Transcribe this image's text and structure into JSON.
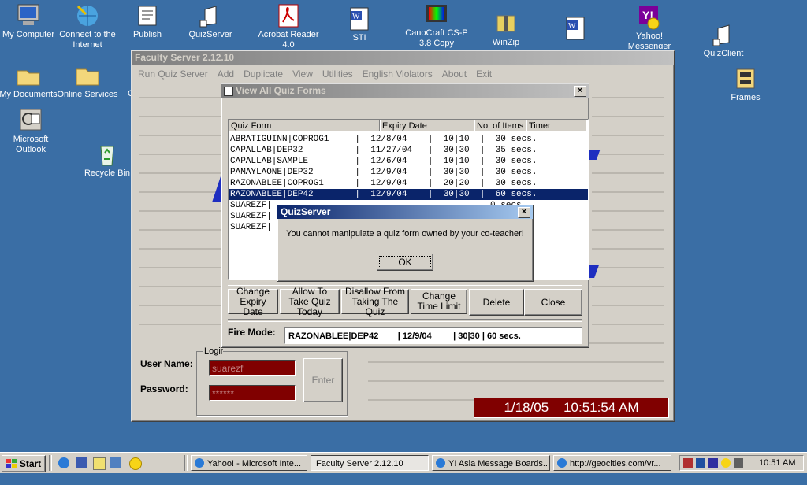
{
  "desktop": {
    "icons": [
      {
        "label": "My Computer"
      },
      {
        "label": "Connect to the Internet"
      },
      {
        "label": "Publish"
      },
      {
        "label": "QuizServer"
      },
      {
        "label": "Acrobat Reader 4.0"
      },
      {
        "label": "STI"
      },
      {
        "label": "CanoCraft CS-P 3.8 Copy"
      },
      {
        "label": "WinZip"
      },
      {
        "label": "Yahoo! Messenger"
      },
      {
        "label": "QuizClient"
      },
      {
        "label": "My Documents"
      },
      {
        "label": "Online Services"
      },
      {
        "label": "Frames"
      },
      {
        "label": "Microsoft Outlook"
      },
      {
        "label": "Recycle Bin"
      }
    ]
  },
  "main_window": {
    "title": "Faculty Server 2.12.10",
    "menu": [
      "Run Quiz Server",
      "Add",
      "Duplicate",
      "View",
      "Utilities",
      "English Violators",
      "About",
      "Exit"
    ],
    "login": {
      "group_label": "Login",
      "username_label": "User Name:",
      "username_value": "suarezf",
      "password_label": "Password:",
      "password_value": "******",
      "enter_label": "Enter"
    },
    "clock": "1/18/05    10:51:54 AM"
  },
  "quiz_window": {
    "title": "View All Quiz Forms",
    "columns": [
      "Quiz Form",
      "Expiry Date",
      "No. of Items",
      "Timer"
    ],
    "rows": [
      {
        "text": "ABRATIGUINN|COPROG1     |  12/8/04    |  10|10  |  30 secs."
      },
      {
        "text": "CAPALLAB|DEP32          |  11/27/04   |  30|30  |  35 secs."
      },
      {
        "text": "CAPALLAB|SAMPLE         |  12/6/04    |  10|10  |  30 secs."
      },
      {
        "text": "PAMAYLAONE|DEP32        |  12/9/04    |  30|30  |  30 secs."
      },
      {
        "text": "RAZONABLEE|COPROG1      |  12/9/04    |  20|20  |  30 secs."
      },
      {
        "text": "RAZONABLEE|DEP42        |  12/9/04    |  30|30  |  60 secs."
      },
      {
        "text": "SUAREZF|                                          0 secs."
      },
      {
        "text": "SUAREZF|                                          0 secs."
      },
      {
        "text": "SUAREZF|                                          0 secs."
      }
    ],
    "selected_index": 5,
    "buttons": {
      "change_expiry": "Change Expiry Date",
      "allow_today": "Allow To Take Quiz Today",
      "disallow": "Disallow From Taking The Quiz",
      "change_time": "Change Time Limit",
      "delete": "Delete",
      "close": "Close"
    },
    "fire_mode_label": "Fire Mode:",
    "fire_mode_value": "RAZONABLEE|DEP42        | 12/9/04         | 30|30 | 60 secs."
  },
  "dialog": {
    "title": "QuizServer",
    "message": "You cannot manipulate a quiz form owned by your co-teacher!",
    "ok_label": "OK"
  },
  "taskbar": {
    "start_label": "Start",
    "tasks": [
      "Yahoo! - Microsoft Inte...",
      "Faculty Server 2.12.10",
      "Y! Asia Message Boards...",
      "http://geocities.com/vr..."
    ],
    "clock": "10:51 AM"
  }
}
